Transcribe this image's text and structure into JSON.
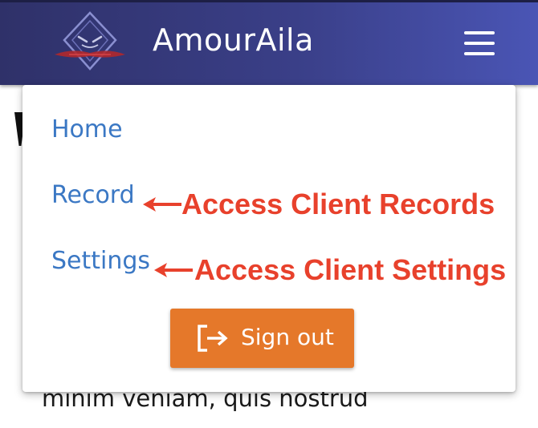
{
  "header": {
    "app_title": "AmourAila",
    "logo_icon": "diamond-mask-logo-icon",
    "menu_icon": "hamburger-menu-icon",
    "background_color": "#3a3f88"
  },
  "menu": {
    "items": [
      {
        "label": "Home"
      },
      {
        "label": "Record"
      },
      {
        "label": "Settings"
      }
    ],
    "link_color": "#3b78c4",
    "signout": {
      "label": "Sign out",
      "icon": "sign-out-icon",
      "color": "#e5782a"
    }
  },
  "annotations": {
    "record": "Access Client Records",
    "settings": "Access Client Settings",
    "color": "#e8412c"
  },
  "background_content": {
    "text_line": "minim veniam, quis nostrud"
  }
}
